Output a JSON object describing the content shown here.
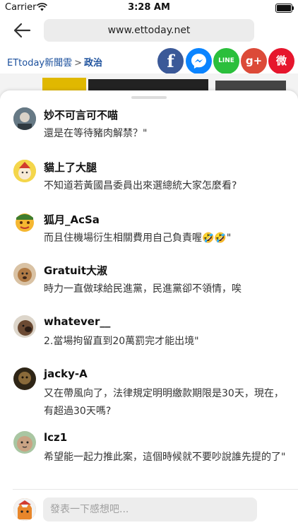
{
  "status_bar": {
    "carrier": "Carrier",
    "time": "3:28 AM"
  },
  "browser": {
    "url": "www.ettoday.net"
  },
  "breadcrumb": {
    "site": "ETtoday新聞雲",
    "separator": ">",
    "section": "政治"
  },
  "share": {
    "facebook": "f",
    "messenger": "~",
    "line": "LINE",
    "google_plus": "g+",
    "weibo": "微"
  },
  "comments": [
    {
      "name": "妙不可言可不喵",
      "text": "還是在等待豬肉解禁？\""
    },
    {
      "name": "貓上了大腿",
      "text": "不知道若黃國昌委員出來選總統大家怎麼看?"
    },
    {
      "name": "狐月_AcSa",
      "text": "而且住機場衍生相關費用自己負責喔🤣🤣\""
    },
    {
      "name": "Gratuit大淑",
      "text": "時力一直做球給民進黨，民進黨卻不領情，唉"
    },
    {
      "name": "whatever__",
      "text": "2.當場拘留直到20萬罰完才能出境\""
    },
    {
      "name": "jacky-A",
      "text": "又在帶風向了，法律規定明明繳款期限是30天，現在，有超過30天嗎?"
    },
    {
      "name": "lcz1",
      "text": "希望能一起力推此案，這個時候就不要吵說誰先提的了\""
    }
  ],
  "composer": {
    "placeholder": "發表一下感想吧..."
  },
  "colors": {
    "link": "#1a4f9c",
    "facebook": "#3b5998",
    "line": "#2bbf3c",
    "google": "#dc4a38",
    "weibo": "#e6162d"
  }
}
